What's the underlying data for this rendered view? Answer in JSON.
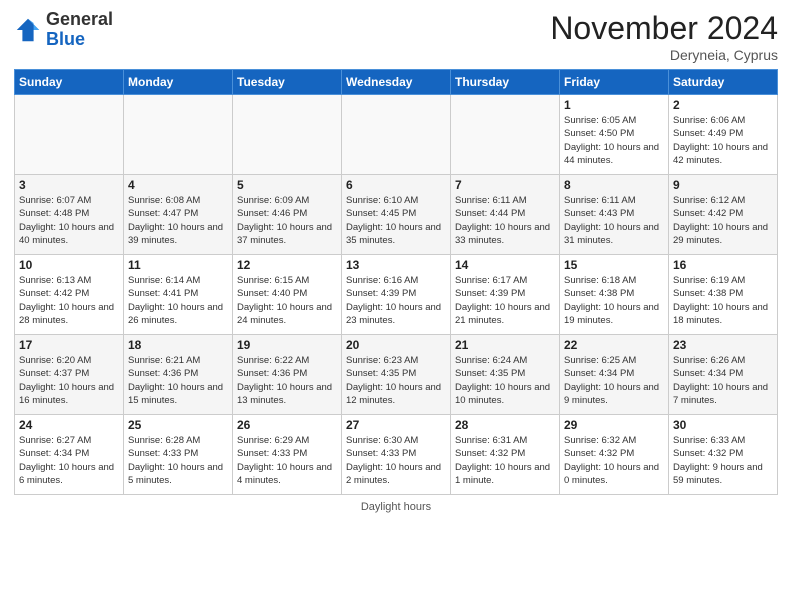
{
  "header": {
    "logo_general": "General",
    "logo_blue": "Blue",
    "month_title": "November 2024",
    "location": "Deryneia, Cyprus"
  },
  "weekdays": [
    "Sunday",
    "Monday",
    "Tuesday",
    "Wednesday",
    "Thursday",
    "Friday",
    "Saturday"
  ],
  "weeks": [
    [
      {
        "day": "",
        "info": ""
      },
      {
        "day": "",
        "info": ""
      },
      {
        "day": "",
        "info": ""
      },
      {
        "day": "",
        "info": ""
      },
      {
        "day": "",
        "info": ""
      },
      {
        "day": "1",
        "info": "Sunrise: 6:05 AM\nSunset: 4:50 PM\nDaylight: 10 hours and 44 minutes."
      },
      {
        "day": "2",
        "info": "Sunrise: 6:06 AM\nSunset: 4:49 PM\nDaylight: 10 hours and 42 minutes."
      }
    ],
    [
      {
        "day": "3",
        "info": "Sunrise: 6:07 AM\nSunset: 4:48 PM\nDaylight: 10 hours and 40 minutes."
      },
      {
        "day": "4",
        "info": "Sunrise: 6:08 AM\nSunset: 4:47 PM\nDaylight: 10 hours and 39 minutes."
      },
      {
        "day": "5",
        "info": "Sunrise: 6:09 AM\nSunset: 4:46 PM\nDaylight: 10 hours and 37 minutes."
      },
      {
        "day": "6",
        "info": "Sunrise: 6:10 AM\nSunset: 4:45 PM\nDaylight: 10 hours and 35 minutes."
      },
      {
        "day": "7",
        "info": "Sunrise: 6:11 AM\nSunset: 4:44 PM\nDaylight: 10 hours and 33 minutes."
      },
      {
        "day": "8",
        "info": "Sunrise: 6:11 AM\nSunset: 4:43 PM\nDaylight: 10 hours and 31 minutes."
      },
      {
        "day": "9",
        "info": "Sunrise: 6:12 AM\nSunset: 4:42 PM\nDaylight: 10 hours and 29 minutes."
      }
    ],
    [
      {
        "day": "10",
        "info": "Sunrise: 6:13 AM\nSunset: 4:42 PM\nDaylight: 10 hours and 28 minutes."
      },
      {
        "day": "11",
        "info": "Sunrise: 6:14 AM\nSunset: 4:41 PM\nDaylight: 10 hours and 26 minutes."
      },
      {
        "day": "12",
        "info": "Sunrise: 6:15 AM\nSunset: 4:40 PM\nDaylight: 10 hours and 24 minutes."
      },
      {
        "day": "13",
        "info": "Sunrise: 6:16 AM\nSunset: 4:39 PM\nDaylight: 10 hours and 23 minutes."
      },
      {
        "day": "14",
        "info": "Sunrise: 6:17 AM\nSunset: 4:39 PM\nDaylight: 10 hours and 21 minutes."
      },
      {
        "day": "15",
        "info": "Sunrise: 6:18 AM\nSunset: 4:38 PM\nDaylight: 10 hours and 19 minutes."
      },
      {
        "day": "16",
        "info": "Sunrise: 6:19 AM\nSunset: 4:38 PM\nDaylight: 10 hours and 18 minutes."
      }
    ],
    [
      {
        "day": "17",
        "info": "Sunrise: 6:20 AM\nSunset: 4:37 PM\nDaylight: 10 hours and 16 minutes."
      },
      {
        "day": "18",
        "info": "Sunrise: 6:21 AM\nSunset: 4:36 PM\nDaylight: 10 hours and 15 minutes."
      },
      {
        "day": "19",
        "info": "Sunrise: 6:22 AM\nSunset: 4:36 PM\nDaylight: 10 hours and 13 minutes."
      },
      {
        "day": "20",
        "info": "Sunrise: 6:23 AM\nSunset: 4:35 PM\nDaylight: 10 hours and 12 minutes."
      },
      {
        "day": "21",
        "info": "Sunrise: 6:24 AM\nSunset: 4:35 PM\nDaylight: 10 hours and 10 minutes."
      },
      {
        "day": "22",
        "info": "Sunrise: 6:25 AM\nSunset: 4:34 PM\nDaylight: 10 hours and 9 minutes."
      },
      {
        "day": "23",
        "info": "Sunrise: 6:26 AM\nSunset: 4:34 PM\nDaylight: 10 hours and 7 minutes."
      }
    ],
    [
      {
        "day": "24",
        "info": "Sunrise: 6:27 AM\nSunset: 4:34 PM\nDaylight: 10 hours and 6 minutes."
      },
      {
        "day": "25",
        "info": "Sunrise: 6:28 AM\nSunset: 4:33 PM\nDaylight: 10 hours and 5 minutes."
      },
      {
        "day": "26",
        "info": "Sunrise: 6:29 AM\nSunset: 4:33 PM\nDaylight: 10 hours and 4 minutes."
      },
      {
        "day": "27",
        "info": "Sunrise: 6:30 AM\nSunset: 4:33 PM\nDaylight: 10 hours and 2 minutes."
      },
      {
        "day": "28",
        "info": "Sunrise: 6:31 AM\nSunset: 4:32 PM\nDaylight: 10 hours and 1 minute."
      },
      {
        "day": "29",
        "info": "Sunrise: 6:32 AM\nSunset: 4:32 PM\nDaylight: 10 hours and 0 minutes."
      },
      {
        "day": "30",
        "info": "Sunrise: 6:33 AM\nSunset: 4:32 PM\nDaylight: 9 hours and 59 minutes."
      }
    ]
  ],
  "footer": {
    "daylight_label": "Daylight hours"
  }
}
